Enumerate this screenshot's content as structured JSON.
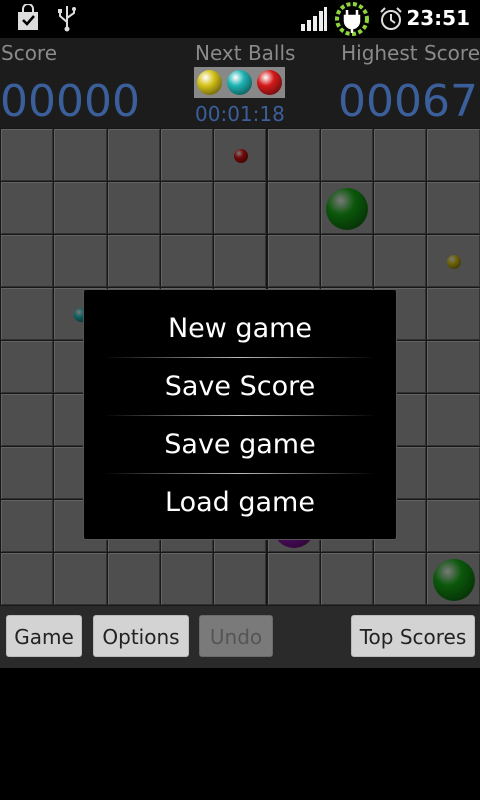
{
  "status_bar": {
    "icons": [
      "shopping-bag-icon",
      "usb-icon",
      "signal-icon",
      "battery-charging-icon",
      "alarm-icon"
    ],
    "time": "23:51"
  },
  "header": {
    "score_label": "Score",
    "score_value": "00000",
    "next_label": "Next Balls",
    "next_balls": [
      "#d4c21a",
      "#1fb3b3",
      "#d41a1a"
    ],
    "timer": "00:01:18",
    "highest_label": "Highest Score",
    "highest_value": "00067"
  },
  "board": {
    "balls": [
      {
        "row": 0,
        "col": 4,
        "color": "#cc1010",
        "size": "small"
      },
      {
        "row": 1,
        "col": 6,
        "color": "#15a015",
        "size": "large"
      },
      {
        "row": 2,
        "col": 8,
        "color": "#c9b410",
        "size": "small"
      },
      {
        "row": 3,
        "col": 1,
        "color": "#1fb3b3",
        "size": "small"
      },
      {
        "row": 7,
        "col": 5,
        "color": "#9a18b8",
        "size": "large"
      },
      {
        "row": 8,
        "col": 8,
        "color": "#15a015",
        "size": "large"
      }
    ]
  },
  "dialog": {
    "items": [
      "New game",
      "Save Score",
      "Save game",
      "Load game"
    ]
  },
  "bottom_bar": {
    "game": "Game",
    "options": "Options",
    "undo": "Undo",
    "top_scores": "Top Scores"
  }
}
